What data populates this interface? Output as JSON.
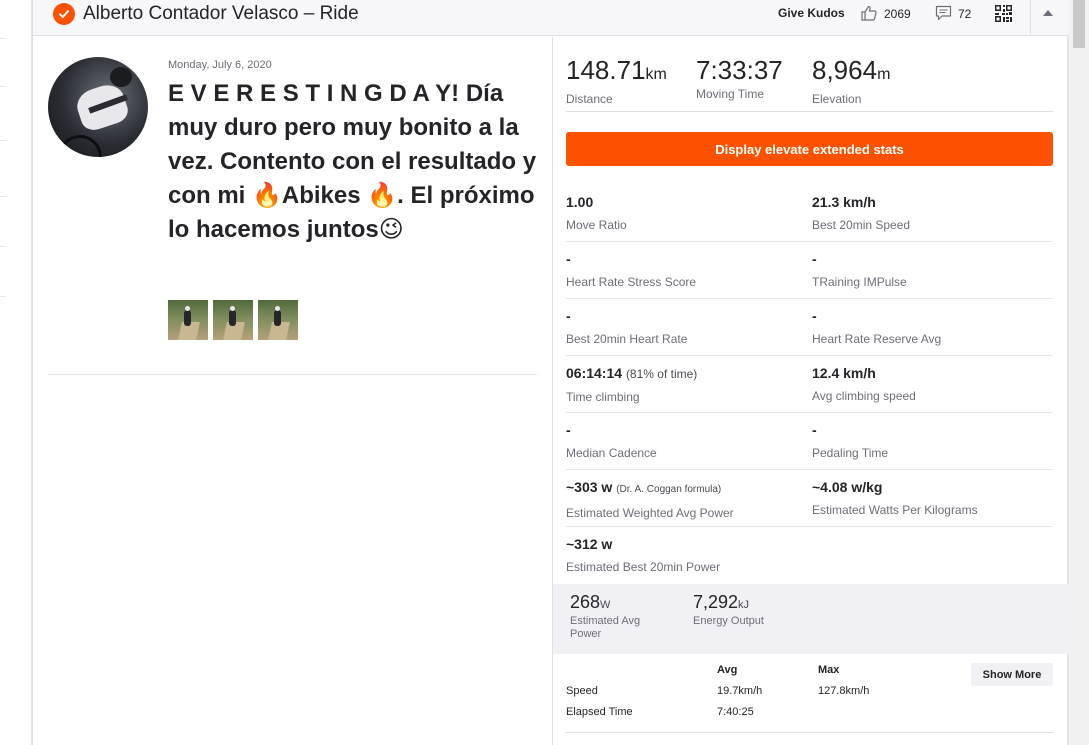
{
  "header": {
    "title": "Alberto Contador Velasco – Ride",
    "give_kudos": "Give Kudos",
    "kudos_count": "2069",
    "comment_count": "72"
  },
  "activity": {
    "date": "Monday, July 6, 2020",
    "title": "E V E R E S T I N G D A Y! Día muy duro pero muy bonito a la vez. Contento con el resultado y con mi 🔥Abikes 🔥. El próximo lo hacemos juntos😉",
    "photo_count": 3
  },
  "summary": {
    "distance": {
      "value": "148.71",
      "unit": "km",
      "label": "Distance"
    },
    "moving_time": {
      "value": "7:33:37",
      "label": "Moving Time"
    },
    "elevation": {
      "value": "8,964",
      "unit": "m",
      "label": "Elevation"
    }
  },
  "elevate_button": "Display elevate extended stats",
  "stats_grid": [
    [
      {
        "value": "1.00",
        "note": "",
        "label": "Move Ratio"
      },
      {
        "value": "21.3 km/h",
        "note": "",
        "label": "Best 20min Speed"
      }
    ],
    [
      {
        "value": "-",
        "note": "",
        "label": "Heart Rate Stress Score"
      },
      {
        "value": "-",
        "note": "",
        "label": "TRaining IMPulse"
      }
    ],
    [
      {
        "value": "-",
        "note": "",
        "label": "Best 20min Heart Rate"
      },
      {
        "value": "-",
        "note": "",
        "label": "Heart Rate Reserve Avg"
      }
    ],
    [
      {
        "value": "06:14:14",
        "note": "(81% of time)",
        "label": "Time climbing"
      },
      {
        "value": "12.4 km/h",
        "note": "",
        "label": "Avg climbing speed"
      }
    ],
    [
      {
        "value": "-",
        "note": "",
        "label": "Median Cadence"
      },
      {
        "value": "-",
        "note": "",
        "label": "Pedaling Time"
      }
    ],
    [
      {
        "value": "~303 w",
        "note": "(Dr. A. Coggan formula)",
        "label": "Estimated Weighted Avg Power"
      },
      {
        "value": "~4.08 w/kg",
        "note": "",
        "label": "Estimated Watts Per Kilograms"
      }
    ],
    [
      {
        "value": "~312 w",
        "note": "",
        "label": "Estimated Best 20min Power"
      }
    ]
  ],
  "power": {
    "avg_power": {
      "value": "268",
      "unit": "W",
      "label_line1": "Estimated Avg",
      "label_line2": "Power"
    },
    "energy": {
      "value": "7,292",
      "unit": "kJ",
      "label": "Energy Output"
    }
  },
  "speed_table": {
    "headers": {
      "avg": "Avg",
      "max": "Max"
    },
    "rows": [
      {
        "label": "Speed",
        "avg": "19.7km/h",
        "max": "127.8km/h"
      },
      {
        "label": "Elapsed Time",
        "avg": "7:40:25",
        "max": ""
      }
    ],
    "show_more": "Show More"
  },
  "colors": {
    "accent": "#fc5200",
    "text": "#242428",
    "muted": "#6d6d78",
    "panel": "#f0f0f5"
  }
}
